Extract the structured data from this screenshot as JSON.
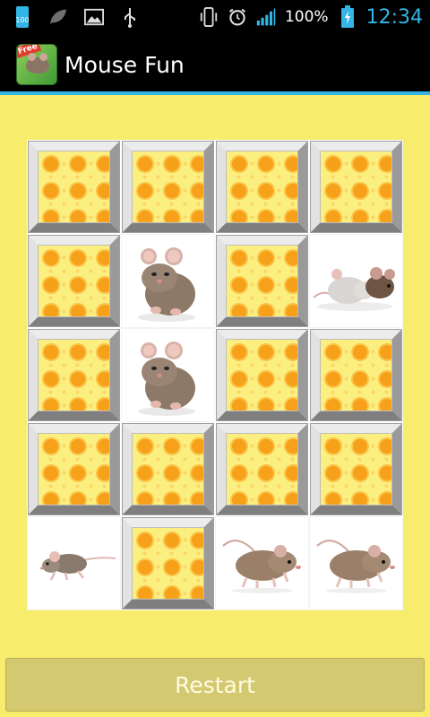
{
  "status_bar": {
    "notification_badge": "100",
    "battery_percent": "100%",
    "time": "12:34",
    "icons": [
      "storage-badge-icon",
      "leaf-icon",
      "image-icon",
      "usb-icon",
      "vibrate-icon",
      "alarm-icon",
      "signal-icon",
      "battery-charging-icon"
    ]
  },
  "app": {
    "title": "Mouse Fun",
    "icon_badge": "Free"
  },
  "board": {
    "rows": 5,
    "cols": 4,
    "cells": [
      [
        "hidden",
        "hidden",
        "hidden",
        "hidden"
      ],
      [
        "hidden",
        "mouse-sitting",
        "hidden",
        "mice-pair"
      ],
      [
        "hidden",
        "mouse-sitting",
        "hidden",
        "hidden"
      ],
      [
        "hidden",
        "hidden",
        "hidden",
        "hidden"
      ],
      [
        "mouse-running",
        "hidden",
        "mouse-walking",
        "mouse-walking"
      ]
    ]
  },
  "restart_button": {
    "label": "Restart"
  },
  "colors": {
    "background": "#f8ec6c",
    "accent": "#33b5e5",
    "button": "#d4c870"
  }
}
